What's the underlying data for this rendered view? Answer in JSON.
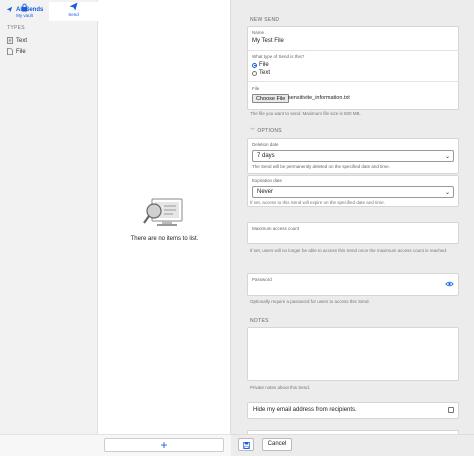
{
  "sidebar": {
    "all_sends": "All Sends",
    "types_heading": "TYPES",
    "items": [
      {
        "label": "Text",
        "icon": "text-file-icon"
      },
      {
        "label": "File",
        "icon": "file-icon"
      }
    ]
  },
  "list": {
    "empty_text": "There are no items to list."
  },
  "bottom_nav": {
    "my_vault": "My vault",
    "send": "Send"
  },
  "add_button_label": "+",
  "form": {
    "section_title": "NEW SEND",
    "name_label": "Name",
    "name_value": "My Test File",
    "type_question": "What type of Send is this?",
    "type_options": [
      "File",
      "Text"
    ],
    "type_selected": "File",
    "file_label": "File",
    "choose_file_button": "Choose File",
    "file_name": "sensitivite_information.txt",
    "file_help": "The file you want to send. Maximum file size is 500 MB.",
    "options_toggle": "OPTIONS",
    "deletion_label": "Deletion date",
    "deletion_value": "7 days",
    "deletion_help": "The Send will be permanently deleted on the specified date and time.",
    "expiration_label": "Expiration date",
    "expiration_value": "Never",
    "expiration_help": "If set, access to this Send will expire on the specified date and time.",
    "max_access_label": "Maximum access count",
    "max_access_help": "If set, users will no longer be able to access this Send once the maximum access count is reached.",
    "password_label": "Password",
    "password_help": "Optionally require a password for users to access this Send.",
    "notes_label": "NOTES",
    "notes_help": "Private notes about this Send.",
    "hide_email_label": "Hide my email address from recipients."
  },
  "actions": {
    "cancel": "Cancel"
  },
  "colors": {
    "accent": "#175ddc",
    "detail_bg": "#ececec",
    "sidebar_bg": "#f2f2f2"
  }
}
